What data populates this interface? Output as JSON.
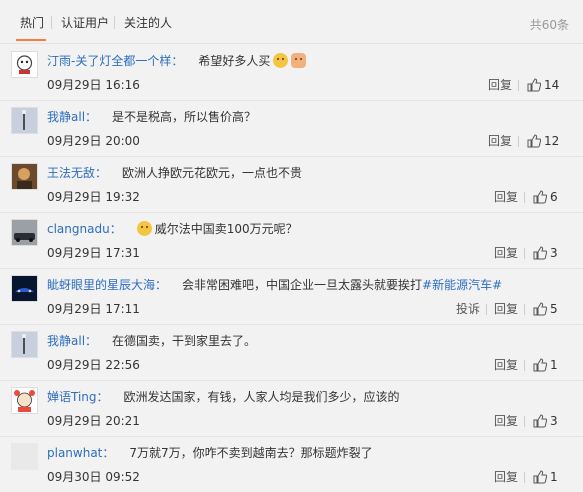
{
  "header": {
    "tabs": [
      {
        "label": "热门"
      },
      {
        "label": "认证用户"
      },
      {
        "label": "关注的人"
      }
    ],
    "total": "共60条"
  },
  "comments": [
    {
      "user": "汀雨-关了灯全都一个样：",
      "text": "希望好多人买",
      "date": "09月29日 16:16",
      "reply_label": "回复",
      "likes": "14"
    },
    {
      "user": "我静all：",
      "text": "是不是税高，所以售价高？",
      "date": "09月29日 20:00",
      "reply_label": "回复",
      "likes": "12"
    },
    {
      "user": "王法无敌：",
      "text": "欧洲人挣欧元花欧元，一点也不贵",
      "date": "09月29日 19:32",
      "reply_label": "回复",
      "likes": "6"
    },
    {
      "user": "clangnadu：",
      "text": "威尔法中国卖100万元呢？",
      "date": "09月29日 17:31",
      "reply_label": "回复",
      "likes": "3"
    },
    {
      "user": "眦蚜眼里的星辰大海：",
      "text": "会非常困难吧，中国企业一旦太露头就要挨打",
      "topic": "#新能源汽车#",
      "date": "09月29日 17:11",
      "report_label": "投诉",
      "reply_label": "回复",
      "likes": "5"
    },
    {
      "user": "我静all：",
      "text": "在德国卖，干到家里去了。",
      "date": "09月29日 22:56",
      "reply_label": "回复",
      "likes": "1"
    },
    {
      "user": "婵语Ting：",
      "text": "欧洲发达国家，有钱，人家人均是我们多少，应该的",
      "date": "09月29日 20:21",
      "reply_label": "回复",
      "likes": "3"
    },
    {
      "user": "planwhat：",
      "text": "7万就7万，你咋不卖到越南去？那标题炸裂了",
      "date": "09月30日 09:52",
      "reply_label": "回复",
      "likes": "1"
    }
  ]
}
